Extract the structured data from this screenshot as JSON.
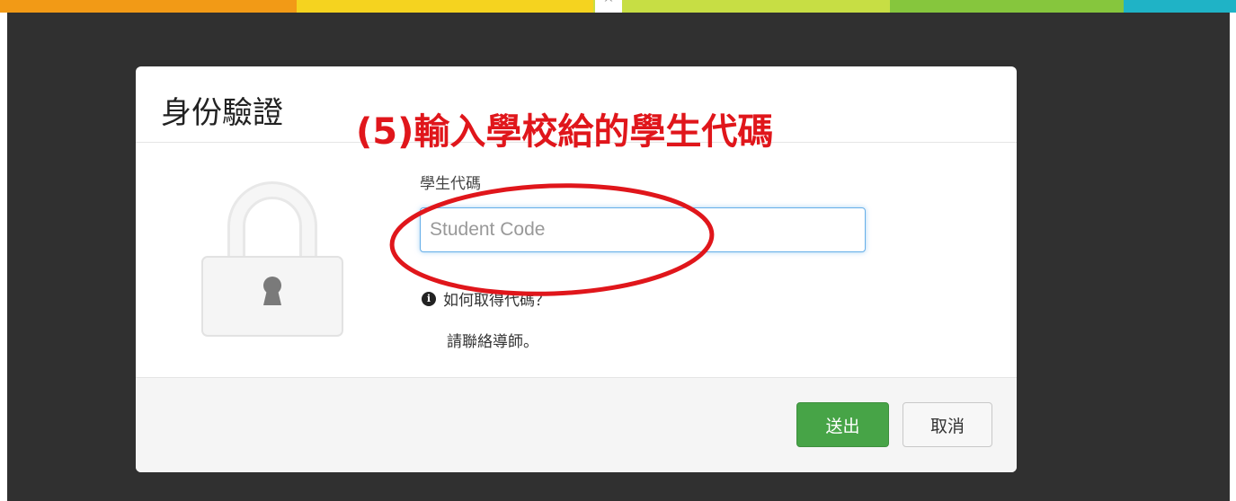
{
  "colors": {
    "stripe": [
      "#f29a16",
      "#f7c81c",
      "#f5e12a",
      "#c7de44",
      "#86c63d",
      "#1fb3c6"
    ],
    "backdrop": "#303030",
    "annotation": "#e0161b",
    "submit_button": "#47a447",
    "input_focus_border": "#66afe9"
  },
  "modal": {
    "title": "身份驗證",
    "annotation": "(5)輸入學校給的學生代碼",
    "lock_icon": "lock-icon",
    "field": {
      "label": "學生代碼",
      "placeholder": "Student Code",
      "value": ""
    },
    "help": {
      "icon": "info-icon",
      "link": "如何取得代碼？",
      "answer": "請聯絡導師。"
    },
    "footer": {
      "submit_label": "送出",
      "cancel_label": "取消"
    }
  }
}
